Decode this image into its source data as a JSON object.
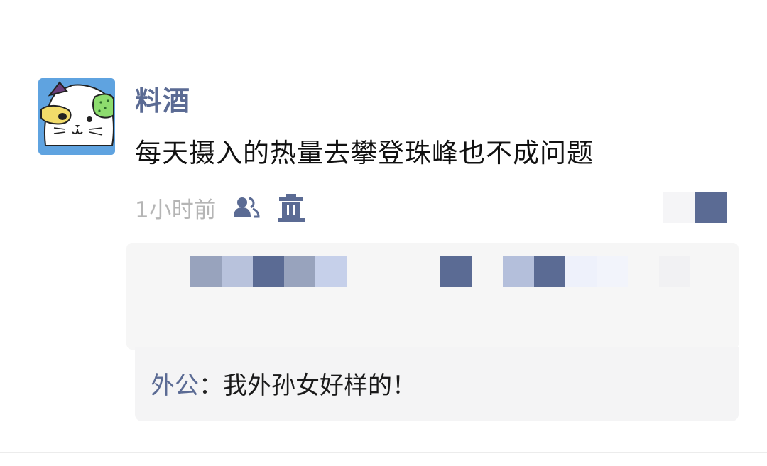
{
  "post": {
    "author": "料酒",
    "text": "每天摄入的热量去攀登珠峰也不成问题",
    "timestamp": "1小时前",
    "icons": {
      "avatar": "cat-avatar",
      "visibility": "people-icon",
      "delete": "trash-icon",
      "more": "more-actions-icon"
    }
  },
  "comments": [
    {
      "author": "外公",
      "separator": "：",
      "text": "我外孙女好样的！"
    }
  ],
  "colors": {
    "link_blue": "#5b6b94",
    "timestamp_gray": "#b5b5b5",
    "comment_bg": "#f4f4f5"
  }
}
